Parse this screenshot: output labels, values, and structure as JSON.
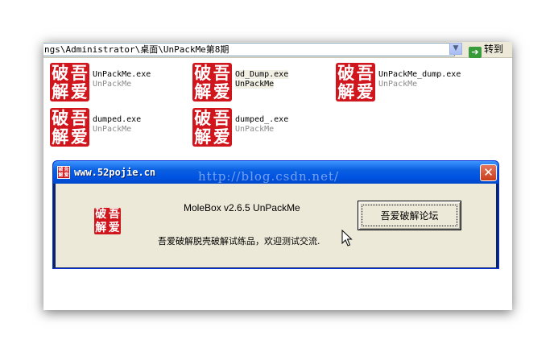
{
  "address_bar": {
    "path": "ngs\\Administrator\\桌面\\UnPackMe第8期",
    "go_label": "转到",
    "dropdown_icon": "chevron-down-icon",
    "go_icon": "green-arrow-icon"
  },
  "stamp": {
    "chars": [
      "破",
      "吾",
      "解",
      "爱"
    ],
    "color": "#d0161c"
  },
  "files": [
    {
      "name": "UnPackMe.exe",
      "desc": "UnPackMe",
      "selected": false
    },
    {
      "name": "Od_Dump.exe",
      "desc": "UnPackMe",
      "selected": true
    },
    {
      "name": "UnPackMe_dump.exe",
      "desc": "UnPackMe",
      "selected": false
    },
    {
      "name": "dumped.exe",
      "desc": "UnPackMe",
      "selected": false
    },
    {
      "name": "dumped_.exe",
      "desc": "UnPackMe",
      "selected": false
    }
  ],
  "dialog": {
    "title": "www.52pojie.cn",
    "watermark": "http://blog.csdn.net/",
    "close_symbol": "✕",
    "version_text": "MoleBox v2.6.5 UnPackMe",
    "description": "吾爱破解脱壳破解试练品，欢迎测试交流.",
    "forum_button_label": "吾爱破解论坛",
    "title_bar_color": "#0054e3",
    "body_color": "#ece9d8"
  }
}
